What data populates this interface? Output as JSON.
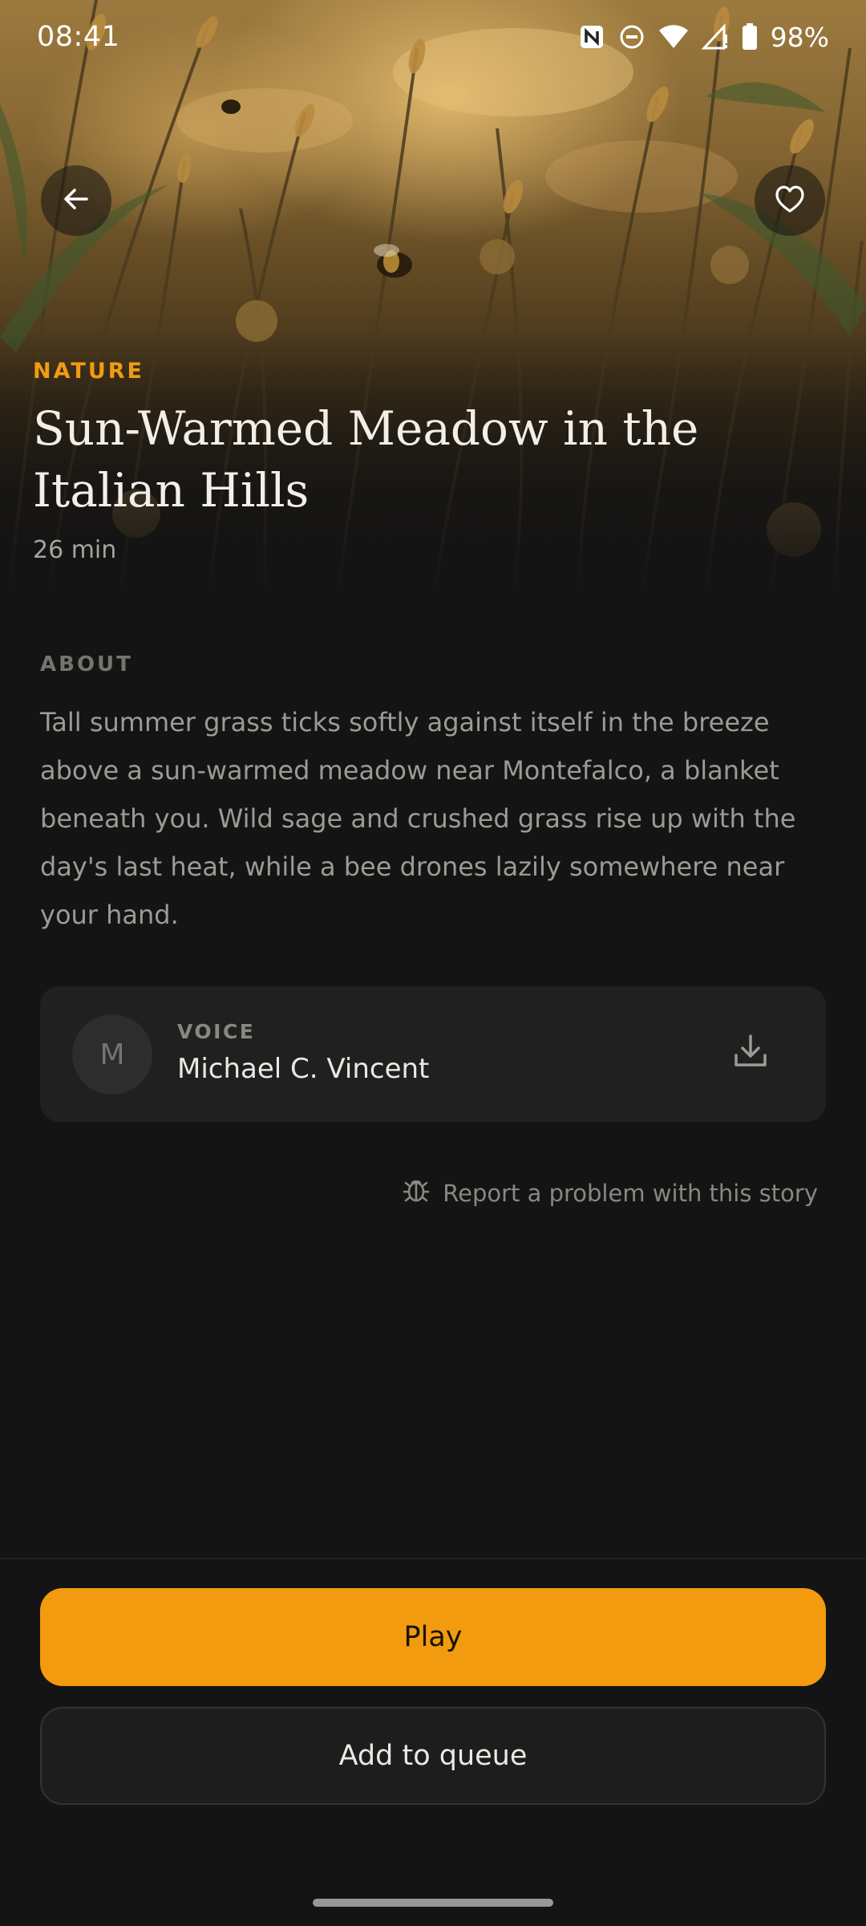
{
  "status_bar": {
    "time": "08:41",
    "battery": "98%",
    "icons": [
      "nfc-icon",
      "do-not-disturb-icon",
      "wifi-icon",
      "signal-icon",
      "battery-icon"
    ]
  },
  "hero": {
    "icons": {
      "back": "arrow-left-icon",
      "favorite": "heart-icon"
    }
  },
  "story": {
    "category": "NATURE",
    "title": "Sun-Warmed Meadow in the Italian Hills",
    "duration": "26 min"
  },
  "about": {
    "label": "ABOUT",
    "text": "Tall summer grass ticks softly against itself in the breeze above a sun-warmed meadow near Montefalco, a blanket beneath you. Wild sage and crushed grass rise up with the day's last heat, while a bee drones lazily somewhere near your hand."
  },
  "voice": {
    "label": "VOICE",
    "name": "Michael C. Vincent",
    "avatar_initial": "M",
    "download_icon": "download-icon"
  },
  "report": {
    "label": "Report a problem with this story",
    "icon": "bug-icon"
  },
  "actions": {
    "play": "Play",
    "queue": "Add to queue"
  },
  "colors": {
    "accent": "#f29b0f",
    "background": "#141414",
    "card": "#202020"
  }
}
